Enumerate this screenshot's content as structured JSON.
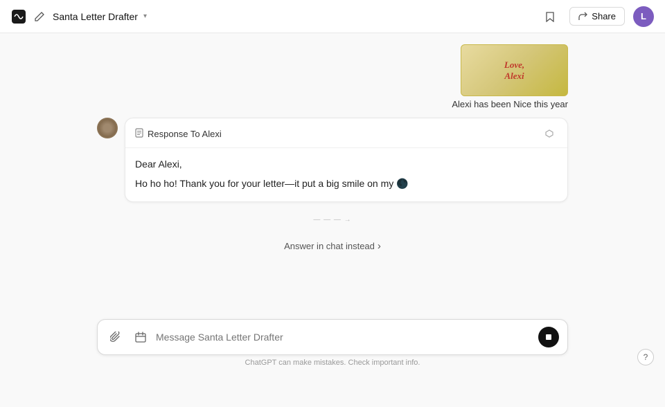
{
  "topbar": {
    "title": "Santa Letter Drafter",
    "share_label": "Share",
    "avatar_letter": "L"
  },
  "letter": {
    "line1": "Love,",
    "line2": "Alexi",
    "caption": "Alexi has been Nice this year"
  },
  "response": {
    "title": "Response To Alexi",
    "greeting": "Dear Alexi,",
    "body": "Ho ho ho! Thank you for your letter—it put a big smile on my 🌑"
  },
  "answer_in_chat": {
    "label": "Answer in chat instead",
    "chevron": "›"
  },
  "input": {
    "placeholder": "Message Santa Letter Drafter"
  },
  "footer": {
    "text": "ChatGPT can make mistakes. Check important info."
  },
  "typing": {
    "dots": "ꗪꗪꗪ",
    "arrow": "→"
  }
}
